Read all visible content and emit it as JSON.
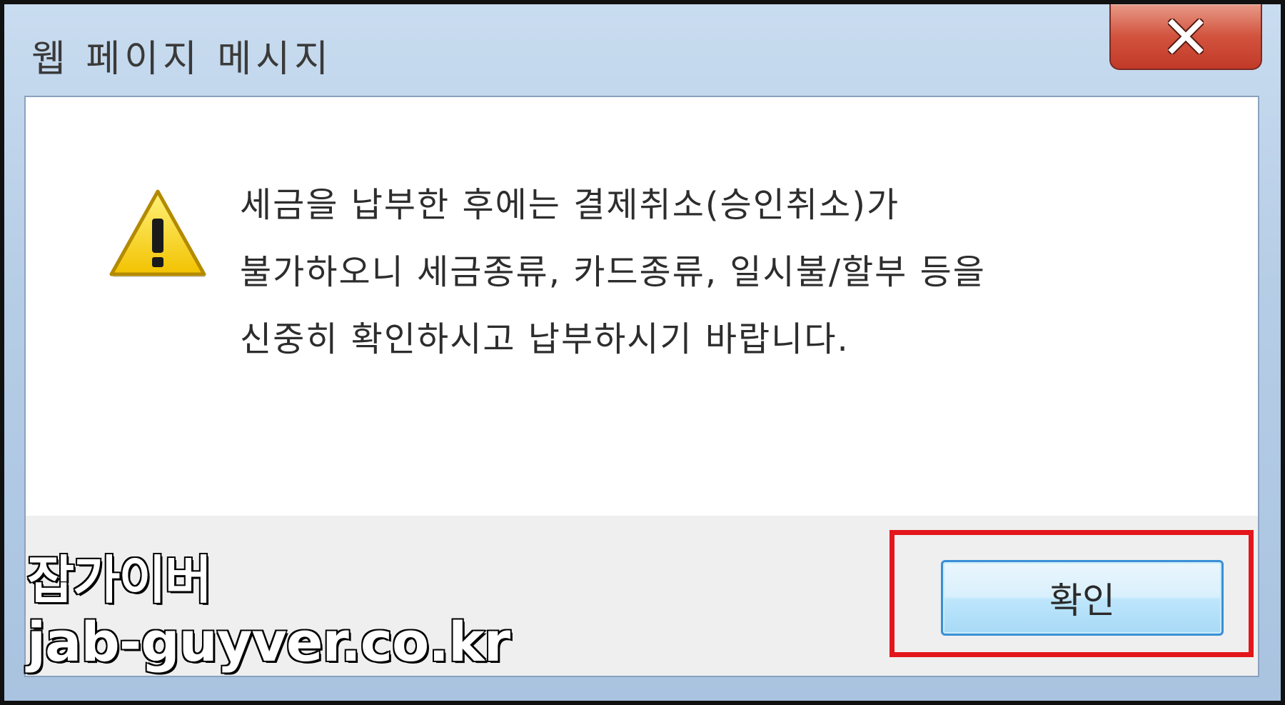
{
  "window": {
    "title": "웹 페이지 메시지"
  },
  "dialog": {
    "message_lines": [
      "세금을 납부한 후에는 결제취소(승인취소)가",
      "불가하오니 세금종류, 카드종류, 일시불/할부 등을",
      "신중히 확인하시고 납부하시기 바랍니다."
    ],
    "icon": "warning-icon",
    "ok_label": "확인"
  },
  "watermark": {
    "line1": "잡가이버",
    "line2": "jab-guyver.co.kr"
  },
  "colors": {
    "title_bar": "#b6cde6",
    "close_button": "#c13a28",
    "highlight_box": "#e3161b",
    "ok_button_border": "#3a8fd6"
  }
}
